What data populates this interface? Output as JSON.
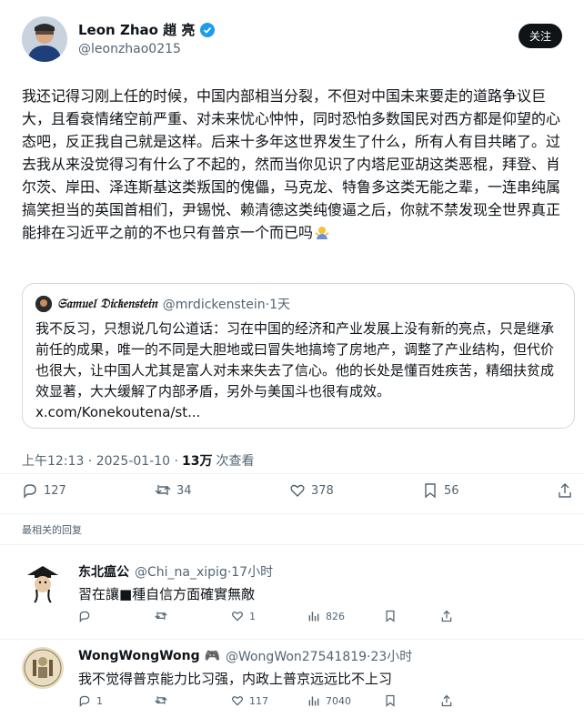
{
  "tweet": {
    "author_name": "Leon Zhao 趙 亮",
    "author_handle": "@leonzhao0215",
    "follow_label": "关注",
    "text": "我还记得习刚上任的时候，中国内部相当分裂，不但对中国未来要走的道路争议巨大，且看衰情绪空前严重、对未来忧心忡忡，同时恐怕多数国民对西方都是仰望的心态吧，反正我自己就是这样。后来十多年这世界发生了什么，所有人有目共睹了。过去我从来没觉得习有什么了不起的，然而当你见识了内塔尼亚胡这类恶棍，拜登、肖尔茨、岸田、泽连斯基这类叛国的傀儡，马克龙、特鲁多这类无能之辈，一连串纯属搞笑担当的英国首相们，尹锡悦、赖清德这类纯傻逼之后，你就不禁发现全世界真正能排在习近平之前的不也只有普京一个而已吗",
    "emoji": "shrug-emoji",
    "timestamp": "上午12:13 · 2025-01-10 ·",
    "views_count": "13万",
    "views_label": "次查看",
    "replies": "127",
    "retweets": "34",
    "likes": "378",
    "bookmarks": "56"
  },
  "quote": {
    "author_name": "𝔖𝔞𝔪𝔲𝔢𝔩 𝔇𝔦𝔠𝔨𝔢𝔫𝔰𝔱𝔢𝔦𝔫",
    "author_handle": "@mrdickenstein·1天",
    "text": "我不反习，只想说几句公道话：习在中国的经济和产业发展上没有新的亮点，只是继承前任的成果，唯一的不同是大胆地或曰冒失地搞垮了房地产，调整了产业结构，但代价也很大，让中国人尤其是富人对未来失去了信心。他的长处是懂百姓疾苦，精细扶贫成效显著，大大缓解了内部矛盾，另外与美国斗也很有成效。",
    "link": "x.com/Konekoutena/st..."
  },
  "section_label": "最相关的回复",
  "replies": [
    {
      "author_name": "东北瘟公",
      "author_handle": "@Chi_na_xipig·17小时",
      "text": "習在讓■種自信方面確實無敵",
      "replies": "",
      "retweets": "",
      "likes": "1",
      "views": "826"
    },
    {
      "author_name": "WongWongWong 🎮",
      "author_handle": "@WongWon27541819·23小时",
      "text": "我不觉得普京能力比习强，内政上普京远远比不上习",
      "replies": "1",
      "retweets": "",
      "likes": "117",
      "views": "7040"
    }
  ],
  "colors": {
    "text": "#0f1419",
    "muted": "#536471",
    "border": "#cfd9de",
    "verified": "#1d9bf0"
  }
}
